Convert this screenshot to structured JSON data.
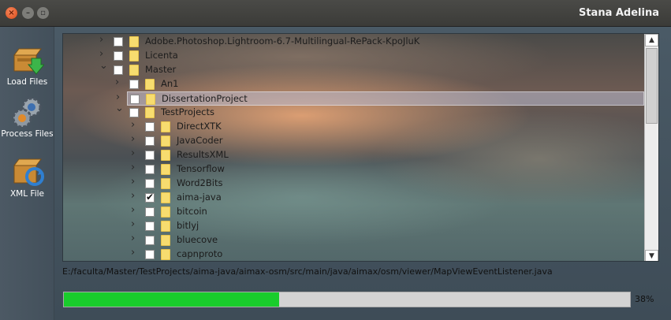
{
  "window": {
    "title": "Stana Adelina"
  },
  "sidebar": {
    "items": [
      {
        "label": "Load Files",
        "icon": "load-files-icon"
      },
      {
        "label": "Process Files",
        "icon": "gears-icon"
      },
      {
        "label": "XML File",
        "icon": "xml-file-icon"
      }
    ]
  },
  "tree": {
    "rows": [
      {
        "name": "Adobe.Photoshop.Lightroom-6.7-Multilingual-RePack-KpoJluK",
        "depth": 0,
        "expanded": false,
        "checked": false,
        "selected": false
      },
      {
        "name": "Licenta",
        "depth": 0,
        "expanded": false,
        "checked": false,
        "selected": false
      },
      {
        "name": "Master",
        "depth": 0,
        "expanded": true,
        "checked": false,
        "selected": false
      },
      {
        "name": "An1",
        "depth": 1,
        "expanded": false,
        "checked": false,
        "selected": false
      },
      {
        "name": "DissertationProject",
        "depth": 1,
        "expanded": false,
        "checked": false,
        "selected": true
      },
      {
        "name": "TestProjects",
        "depth": 1,
        "expanded": true,
        "checked": false,
        "selected": false
      },
      {
        "name": "DirectXTK",
        "depth": 2,
        "expanded": false,
        "checked": false,
        "selected": false
      },
      {
        "name": "JavaCoder",
        "depth": 2,
        "expanded": false,
        "checked": false,
        "selected": false
      },
      {
        "name": "ResultsXML",
        "depth": 2,
        "expanded": false,
        "checked": false,
        "selected": false
      },
      {
        "name": "Tensorflow",
        "depth": 2,
        "expanded": false,
        "checked": false,
        "selected": false
      },
      {
        "name": "Word2Bits",
        "depth": 2,
        "expanded": false,
        "checked": false,
        "selected": false
      },
      {
        "name": "aima-java",
        "depth": 2,
        "expanded": false,
        "checked": true,
        "selected": false
      },
      {
        "name": "bitcoin",
        "depth": 2,
        "expanded": false,
        "checked": false,
        "selected": false
      },
      {
        "name": "bitlyj",
        "depth": 2,
        "expanded": false,
        "checked": false,
        "selected": false
      },
      {
        "name": "bluecove",
        "depth": 2,
        "expanded": false,
        "checked": false,
        "selected": false
      },
      {
        "name": "capnproto",
        "depth": 2,
        "expanded": false,
        "checked": false,
        "selected": false
      }
    ]
  },
  "status": {
    "path": "E:/faculta/Master/TestProjects/aima-java/aimax-osm/src/main/java/aimax/osm/viewer/MapViewEventListener.java",
    "progress": 0.38,
    "progress_label": "38%"
  },
  "colors": {
    "progress_fill": "#19cc2c",
    "title_text": "#f2f2f2",
    "folder": "#f7dc6f"
  }
}
